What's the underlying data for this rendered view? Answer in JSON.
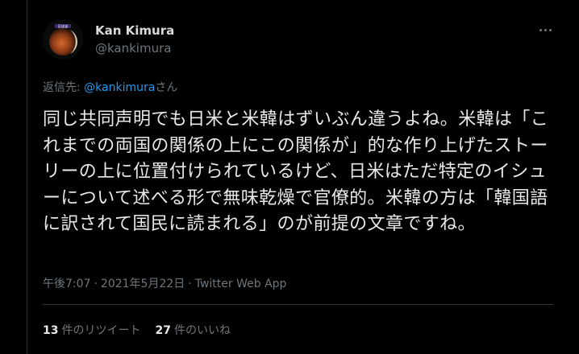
{
  "author": {
    "name": "Kan Kimura",
    "handle": "@kankimura",
    "avatar_caption": "日経新"
  },
  "reply": {
    "prefix": "返信先: ",
    "mention": "@kankimura",
    "suffix": "さん"
  },
  "tweet": {
    "text": "同じ共同声明でも日米と米韓はずいぶん違うよね。米韓は「これまでの両国の関係の上にこの関係が」的な作り上げたストーリーの上に位置付けられているけど、日米はただ特定のイシューについて述べる形で無味乾燥で官僚的。米韓の方は「韓国語に訳されて国民に読まれる」のが前提の文章ですね。"
  },
  "meta": {
    "time": "午後7:07",
    "separator": "·",
    "date": "2021年5月22日",
    "app": "Twitter Web App"
  },
  "stats": {
    "retweets_count": "13",
    "retweets_label": "件のリツイート",
    "likes_count": "27",
    "likes_label": "件のいいね"
  },
  "colors": {
    "background": "#000000",
    "link": "#1d9bf0",
    "secondary": "#6e767d"
  }
}
